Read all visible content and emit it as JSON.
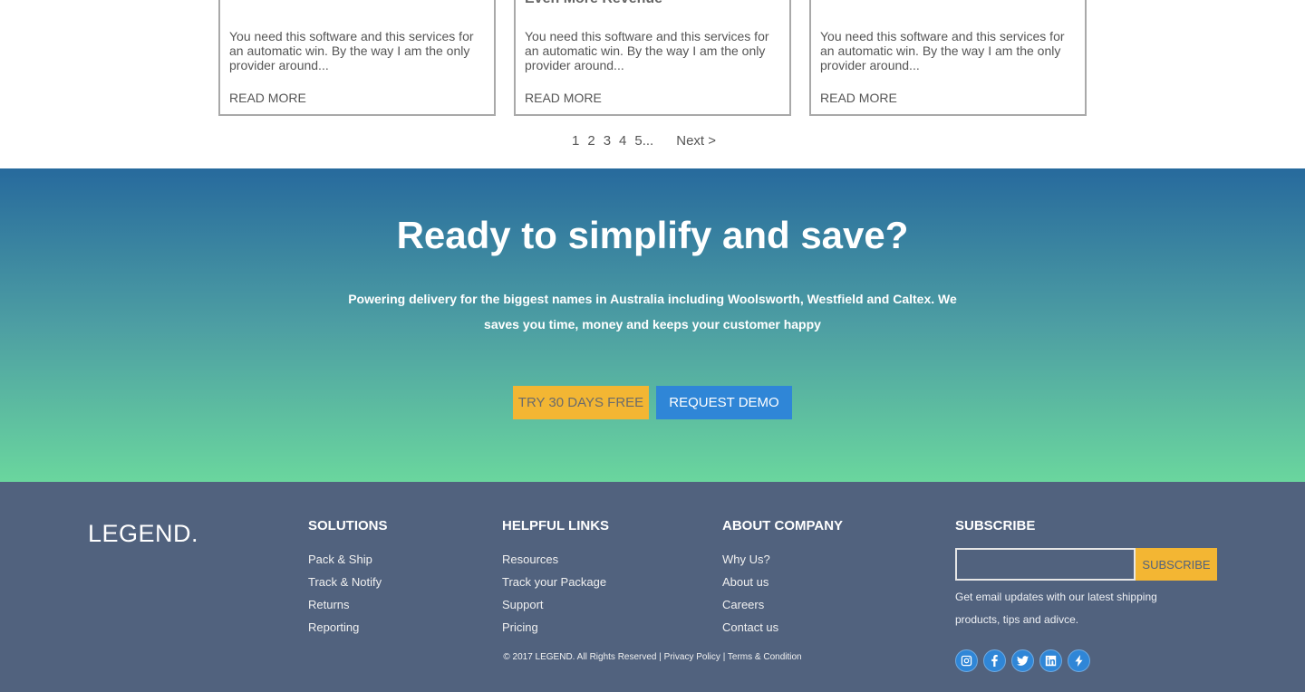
{
  "cards": [
    {
      "title": "",
      "text": "You need this software and this services for an automatic win. By the way I am the only provider around...",
      "link": "READ MORE"
    },
    {
      "title": "Even More Revenue",
      "text": "You need this software and this services for an automatic win. By the way I am the only provider around...",
      "link": "READ MORE"
    },
    {
      "title": "",
      "text": "You need this software and this services for an automatic win. By the way I am the only provider around...",
      "link": "READ MORE"
    }
  ],
  "pagination": {
    "pages": [
      "1",
      "2",
      "3",
      "4",
      "5..."
    ],
    "next": "Next >"
  },
  "cta": {
    "title": "Ready to simplify and save?",
    "subtitle": "Powering delivery for the biggest names in Australia including Woolsworth, Westfield and Caltex. We saves you time, money and keeps your customer happy",
    "try_label": "TRY 30 DAYS FREE",
    "demo_label": "REQUEST DEMO"
  },
  "footer": {
    "logo": "LEGEND.",
    "solutions": {
      "heading": "SOLUTIONS",
      "items": [
        "Pack & Ship",
        "Track & Notify",
        "Returns",
        "Reporting"
      ]
    },
    "helpful": {
      "heading": "HELPFUL LINKS",
      "items": [
        "Resources",
        "Track your Package",
        "Support",
        "Pricing"
      ]
    },
    "about": {
      "heading": "ABOUT COMPANY",
      "items": [
        "Why Us?",
        "About us",
        "Careers",
        "Contact us"
      ]
    },
    "subscribe": {
      "heading": "SUBSCRIBE",
      "input_value": "",
      "button_label": "SUBSCRIBE",
      "text": "Get email updates with our latest shipping products, tips and adivce."
    },
    "social_icons": [
      "instagram-icon",
      "facebook-icon",
      "twitter-icon",
      "linkedin-icon",
      "bolt-icon"
    ],
    "copyright": {
      "text": "© 2017 LEGEND. All Rights Reserved |",
      "privacy": "Privacy Policy",
      "sep": "|",
      "terms": "Terms & Condition"
    }
  },
  "colors": {
    "gradient_top": "#276a9d",
    "gradient_bottom": "#6ad69e",
    "accent_yellow": "#f3b633",
    "accent_blue": "#2f86d7",
    "footer_bg": "#51627e"
  }
}
